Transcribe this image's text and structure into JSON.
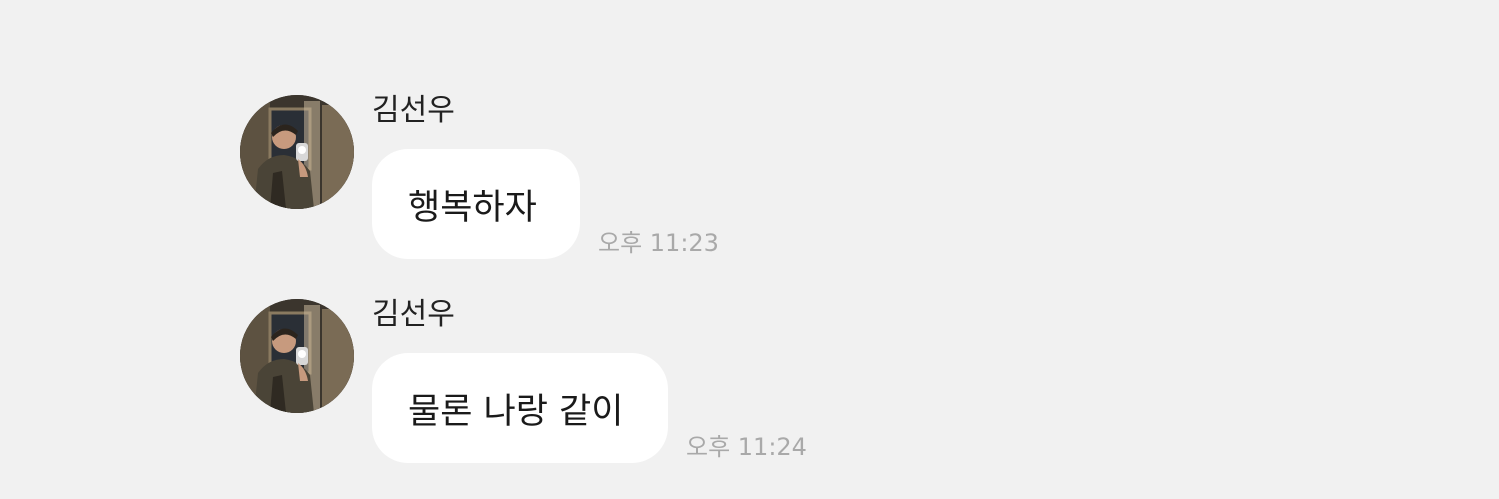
{
  "messages": [
    {
      "sender": "김선우",
      "text": "행복하자",
      "time": "오후 11:23",
      "avatar_icon": "profile-photo"
    },
    {
      "sender": "김선우",
      "text": "물론 나랑 같이",
      "time": "오후 11:24",
      "avatar_icon": "profile-photo"
    }
  ],
  "colors": {
    "background": "#f1f1f1",
    "bubble": "#ffffff",
    "timestamp": "#a9a9a9"
  }
}
